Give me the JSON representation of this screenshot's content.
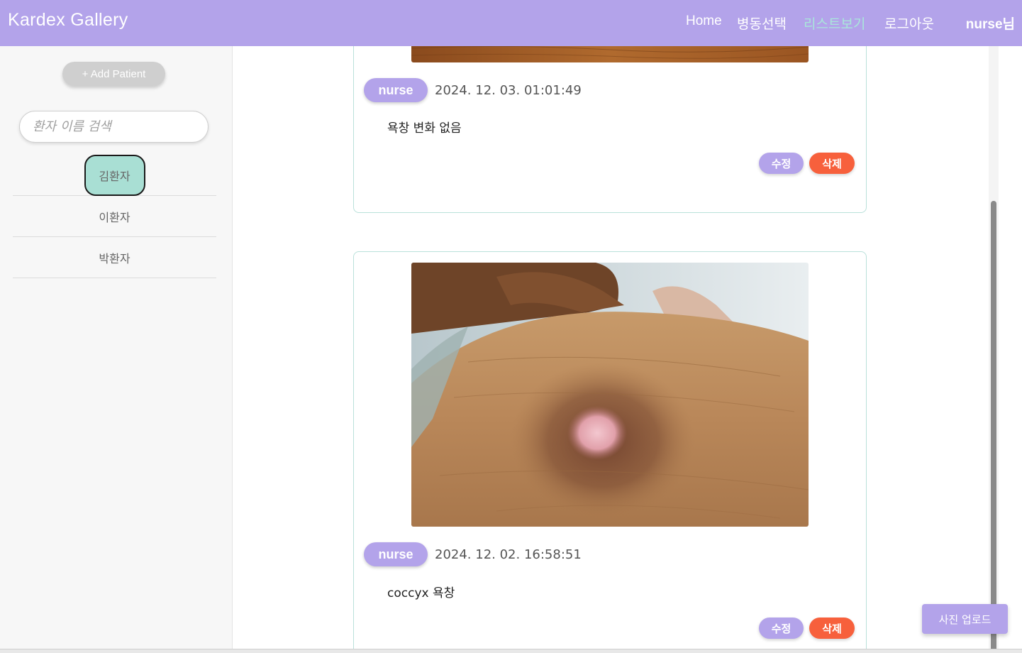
{
  "navbar": {
    "brand": "Kardex Gallery",
    "links": [
      "Home",
      "병동선택",
      "리스트보기",
      "로그아웃"
    ],
    "user": "nurse님"
  },
  "sidebar": {
    "add_label": "+ Add Patient",
    "search_placeholder": "환자 이름 검색",
    "patients": [
      "김환자",
      "이환자",
      "박환자"
    ]
  },
  "posts": [
    {
      "author": "nurse",
      "timestamp": "2024. 12. 03. 01:01:49",
      "note": "욕창 변화 없음",
      "edit_label": "수정",
      "delete_label": "삭제"
    },
    {
      "author": "nurse",
      "timestamp": "2024. 12. 02. 16:58:51",
      "note": "coccyx 욕창",
      "edit_label": "수정",
      "delete_label": "삭제"
    }
  ],
  "upload_label": "사진 업로드",
  "colors": {
    "primary": "#b3a3ea",
    "active": "#a9e7da",
    "danger": "#f7603c",
    "selected": "#a9dfd4"
  }
}
